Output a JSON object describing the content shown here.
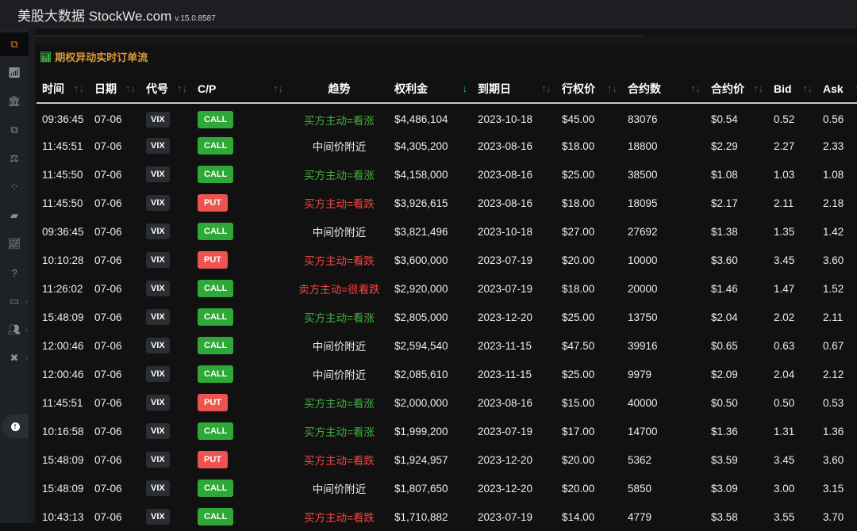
{
  "app": {
    "title": "美股大数据 StockWe.com",
    "version": "v.15.0.8587"
  },
  "sidebar": {
    "items": [
      "flow",
      "analytics",
      "bank",
      "flow2",
      "balance",
      "network",
      "whale",
      "chart",
      "help",
      "monitor",
      "users",
      "tools"
    ],
    "info": "info"
  },
  "panel": {
    "title": "期权异动实时订单流",
    "icon": "bar-chart-icon"
  },
  "colors": {
    "call": "#2ea836",
    "put": "#ef5350",
    "bull": "#3fae3f",
    "bear": "#f0473e",
    "neutral": "#ececec"
  },
  "columns": [
    "时间",
    "日期",
    "代号",
    "C/P",
    "趋势",
    "权利金",
    "到期日",
    "行权价",
    "合约数",
    "合约价",
    "Bid",
    "Ask"
  ],
  "rows": [
    {
      "time": "09:36:45",
      "date": "07-06",
      "sym": "VIX",
      "cp": "CALL",
      "trend": "买方主动=看涨",
      "tone": "bull",
      "prem": "$4,486,104",
      "exp": "2023-10-18",
      "strike": "$45.00",
      "qty": "83076",
      "price": "$0.54",
      "bid": "0.52",
      "ask": "0.56"
    },
    {
      "time": "11:45:51",
      "date": "07-06",
      "sym": "VIX",
      "cp": "CALL",
      "trend": "中间价附近",
      "tone": "neutral",
      "prem": "$4,305,200",
      "exp": "2023-08-16",
      "strike": "$18.00",
      "qty": "18800",
      "price": "$2.29",
      "bid": "2.27",
      "ask": "2.33"
    },
    {
      "time": "11:45:50",
      "date": "07-06",
      "sym": "VIX",
      "cp": "CALL",
      "trend": "买方主动=看涨",
      "tone": "bull",
      "prem": "$4,158,000",
      "exp": "2023-08-16",
      "strike": "$25.00",
      "qty": "38500",
      "price": "$1.08",
      "bid": "1.03",
      "ask": "1.08"
    },
    {
      "time": "11:45:50",
      "date": "07-06",
      "sym": "VIX",
      "cp": "PUT",
      "trend": "买方主动=看跌",
      "tone": "bear",
      "prem": "$3,926,615",
      "exp": "2023-08-16",
      "strike": "$18.00",
      "qty": "18095",
      "price": "$2.17",
      "bid": "2.11",
      "ask": "2.18"
    },
    {
      "time": "09:36:45",
      "date": "07-06",
      "sym": "VIX",
      "cp": "CALL",
      "trend": "中间价附近",
      "tone": "neutral",
      "prem": "$3,821,496",
      "exp": "2023-10-18",
      "strike": "$27.00",
      "qty": "27692",
      "price": "$1.38",
      "bid": "1.35",
      "ask": "1.42"
    },
    {
      "time": "10:10:28",
      "date": "07-06",
      "sym": "VIX",
      "cp": "PUT",
      "trend": "买方主动=看跌",
      "tone": "bear",
      "prem": "$3,600,000",
      "exp": "2023-07-19",
      "strike": "$20.00",
      "qty": "10000",
      "price": "$3.60",
      "bid": "3.45",
      "ask": "3.60"
    },
    {
      "time": "11:26:02",
      "date": "07-06",
      "sym": "VIX",
      "cp": "CALL",
      "trend": "卖方主动=很看跌",
      "tone": "bear",
      "prem": "$2,920,000",
      "exp": "2023-07-19",
      "strike": "$18.00",
      "qty": "20000",
      "price": "$1.46",
      "bid": "1.47",
      "ask": "1.52"
    },
    {
      "time": "15:48:09",
      "date": "07-06",
      "sym": "VIX",
      "cp": "CALL",
      "trend": "买方主动=看涨",
      "tone": "bull",
      "prem": "$2,805,000",
      "exp": "2023-12-20",
      "strike": "$25.00",
      "qty": "13750",
      "price": "$2.04",
      "bid": "2.02",
      "ask": "2.11"
    },
    {
      "time": "12:00:46",
      "date": "07-06",
      "sym": "VIX",
      "cp": "CALL",
      "trend": "中间价附近",
      "tone": "neutral",
      "prem": "$2,594,540",
      "exp": "2023-11-15",
      "strike": "$47.50",
      "qty": "39916",
      "price": "$0.65",
      "bid": "0.63",
      "ask": "0.67"
    },
    {
      "time": "12:00:46",
      "date": "07-06",
      "sym": "VIX",
      "cp": "CALL",
      "trend": "中间价附近",
      "tone": "neutral",
      "prem": "$2,085,610",
      "exp": "2023-11-15",
      "strike": "$25.00",
      "qty": "9979",
      "price": "$2.09",
      "bid": "2.04",
      "ask": "2.12"
    },
    {
      "time": "11:45:51",
      "date": "07-06",
      "sym": "VIX",
      "cp": "PUT",
      "trend": "买方主动=看涨",
      "tone": "bull",
      "prem": "$2,000,000",
      "exp": "2023-08-16",
      "strike": "$15.00",
      "qty": "40000",
      "price": "$0.50",
      "bid": "0.50",
      "ask": "0.53"
    },
    {
      "time": "10:16:58",
      "date": "07-06",
      "sym": "VIX",
      "cp": "CALL",
      "trend": "买方主动=看涨",
      "tone": "bull",
      "prem": "$1,999,200",
      "exp": "2023-07-19",
      "strike": "$17.00",
      "qty": "14700",
      "price": "$1.36",
      "bid": "1.31",
      "ask": "1.36"
    },
    {
      "time": "15:48:09",
      "date": "07-06",
      "sym": "VIX",
      "cp": "PUT",
      "trend": "买方主动=看跌",
      "tone": "bear",
      "prem": "$1,924,957",
      "exp": "2023-12-20",
      "strike": "$20.00",
      "qty": "5362",
      "price": "$3.59",
      "bid": "3.45",
      "ask": "3.60"
    },
    {
      "time": "15:48:09",
      "date": "07-06",
      "sym": "VIX",
      "cp": "CALL",
      "trend": "中间价附近",
      "tone": "neutral",
      "prem": "$1,807,650",
      "exp": "2023-12-20",
      "strike": "$20.00",
      "qty": "5850",
      "price": "$3.09",
      "bid": "3.00",
      "ask": "3.15"
    },
    {
      "time": "10:43:13",
      "date": "07-06",
      "sym": "VIX",
      "cp": "CALL",
      "trend": "买方主动=看跌",
      "tone": "bear",
      "prem": "$1,710,882",
      "exp": "2023-07-19",
      "strike": "$14.00",
      "qty": "4779",
      "price": "$3.58",
      "bid": "3.55",
      "ask": "3.70"
    }
  ]
}
